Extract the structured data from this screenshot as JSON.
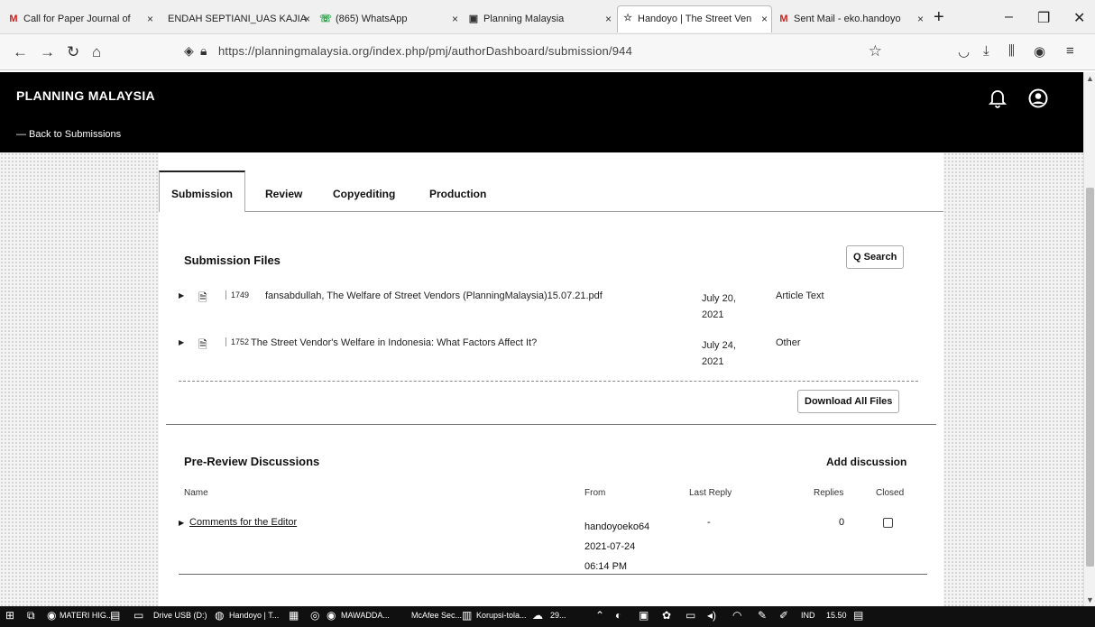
{
  "browser": {
    "tabs": [
      {
        "icon": "M",
        "title": "Call for Paper Journal of",
        "close": "×"
      },
      {
        "icon": "",
        "title": "ENDAH SEPTIANI_UAS KAJIA",
        "close": "×"
      },
      {
        "icon": "☏",
        "title": "(865) WhatsApp",
        "close": "×"
      },
      {
        "icon": "▣",
        "title": "Planning Malaysia",
        "close": "×"
      },
      {
        "icon": "☆",
        "title": "Handoyo | The Street Ven",
        "close": "×"
      },
      {
        "icon": "M",
        "title": "Sent Mail - eko.handoyo",
        "close": "×"
      }
    ],
    "new_tab": "+",
    "window": {
      "minimize": "–",
      "restore": "❐",
      "close": "✕"
    },
    "url": "https://planningmalaysia.org/index.php/pmj/authorDashboard/submission/944"
  },
  "header": {
    "site_title": "PLANNING MALAYSIA",
    "back_link": "— Back to Submissions"
  },
  "workflow_tabs": [
    "Submission",
    "Review",
    "Copyediting",
    "Production"
  ],
  "submission_files": {
    "title": "Submission Files",
    "search_label": "Q Search",
    "files": [
      {
        "id": "1749",
        "name": "fansabdullah, The Welfare of Street Vendors (PlanningMalaysia)15.07.21.pdf",
        "date_line1": "July 20,",
        "date_line2": "2021",
        "type": "Article Text"
      },
      {
        "id": "1752",
        "name": "The Street Vendor's Welfare in Indonesia: What Factors Affect It?",
        "date_line1": "July 24,",
        "date_line2": "2021",
        "type": "Other"
      }
    ],
    "download_all_label": "Download All Files"
  },
  "discussions": {
    "title": "Pre-Review Discussions",
    "add_label": "Add discussion",
    "columns": {
      "name": "Name",
      "from": "From",
      "last_reply": "Last Reply",
      "replies": "Replies",
      "closed": "Closed"
    },
    "rows": [
      {
        "name": "Comments for the Editor",
        "from_user": "handoyoeko64",
        "from_date": "2021-07-24",
        "from_time": "06:14 PM",
        "last_reply": "-",
        "replies": "0"
      }
    ]
  },
  "taskbar": {
    "items": [
      "MATERI HIG...",
      "Drive USB (D:)",
      "Handoyo | T...",
      "MAWADDA...",
      "McAfee Sec...",
      "Korupsi-tola..."
    ],
    "weather": "29...",
    "lang": "IND",
    "time": "15.50"
  }
}
